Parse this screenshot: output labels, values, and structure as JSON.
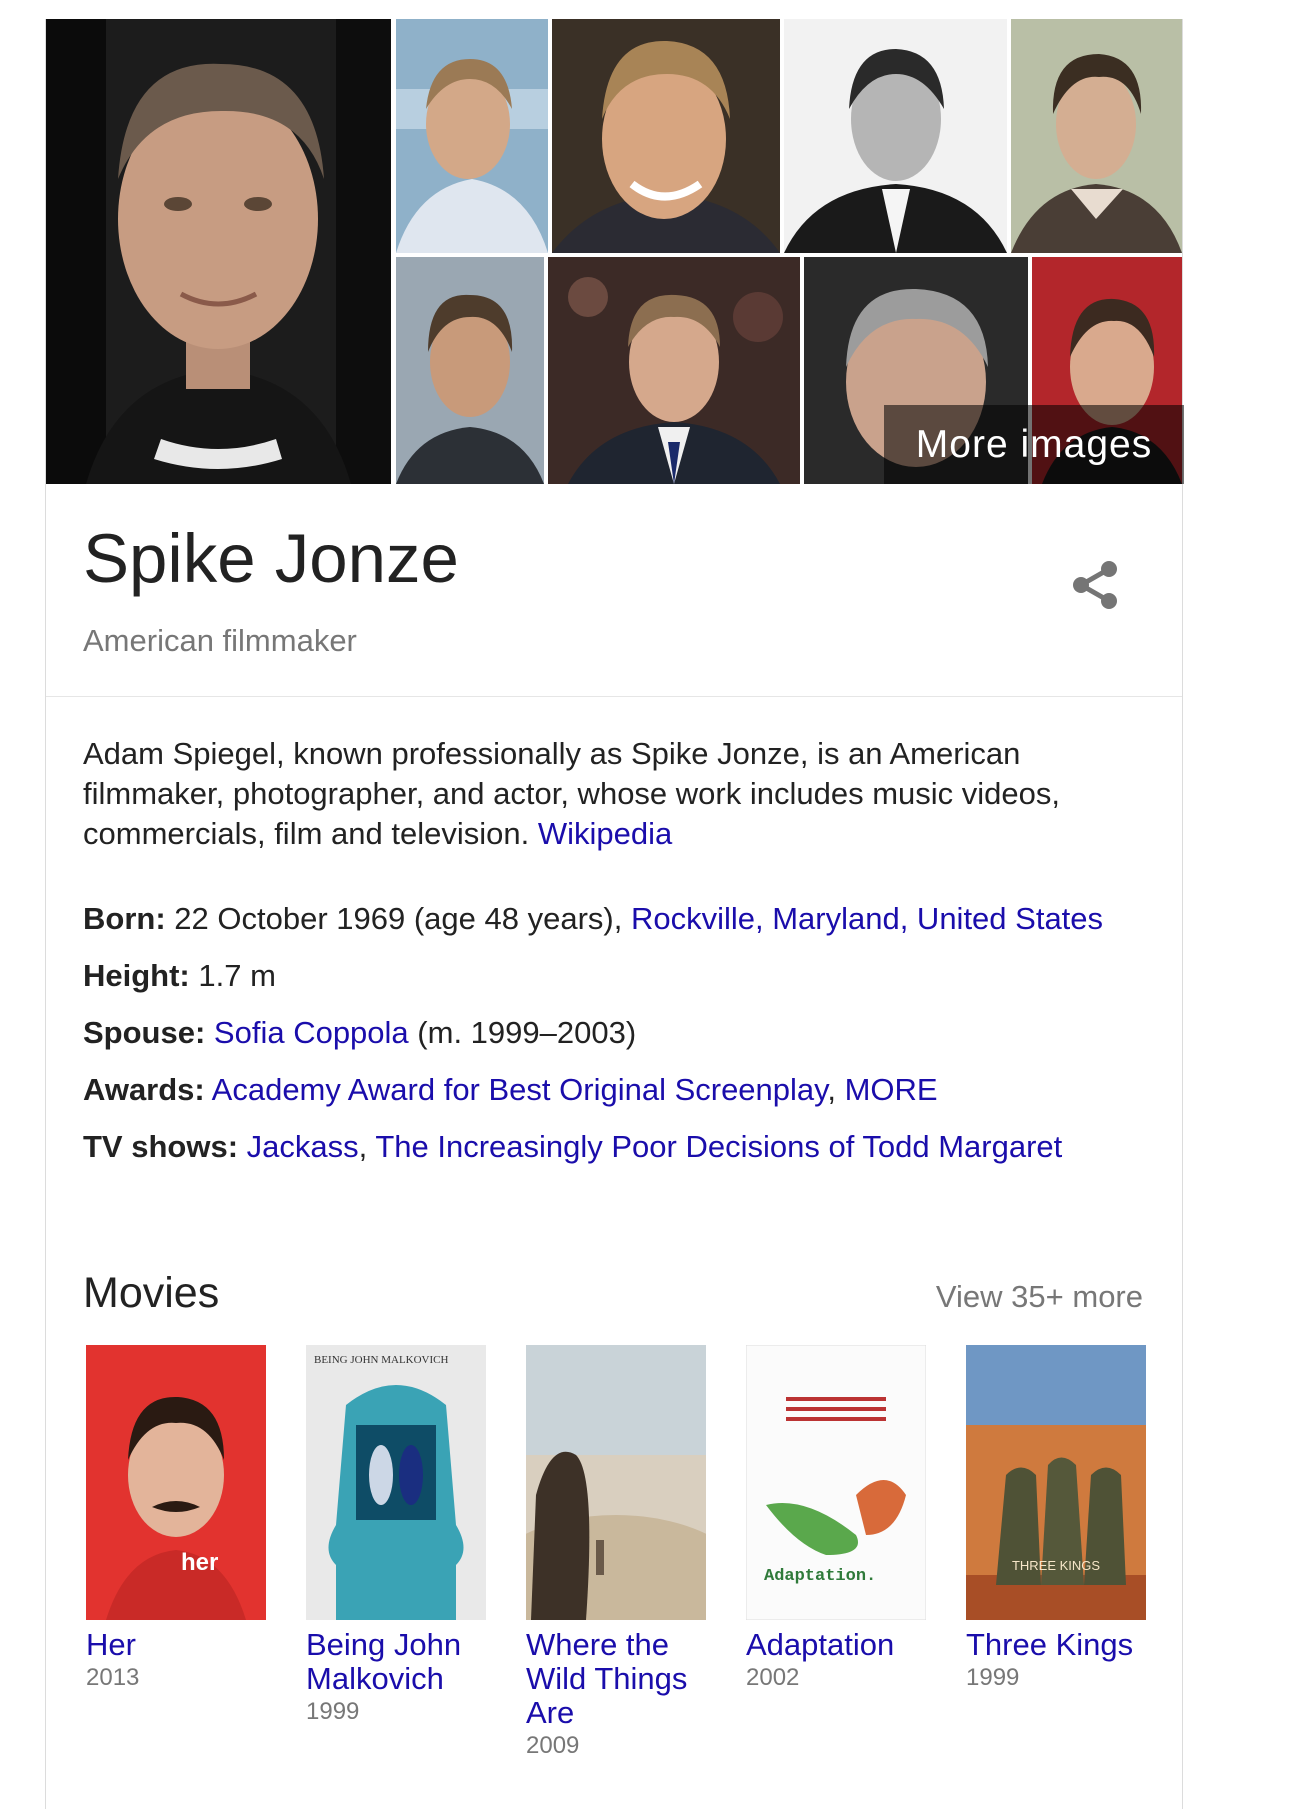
{
  "gallery": {
    "more_images_label": "More images"
  },
  "entity": {
    "name": "Spike Jonze",
    "subtitle": "American filmmaker"
  },
  "description": {
    "text": "Adam Spiegel, known professionally as Spike Jonze, is an American filmmaker, photographer, and actor, whose work includes music videos, commercials, film and television.",
    "source_link": "Wikipedia"
  },
  "facts": {
    "born": {
      "label": "Born:",
      "value": "22 October 1969 (age 48 years),",
      "link": "Rockville, Maryland, United States"
    },
    "height": {
      "label": "Height:",
      "value": "1.7 m"
    },
    "spouse": {
      "label": "Spouse:",
      "link": "Sofia Coppola",
      "value": "(m. 1999–2003)"
    },
    "awards": {
      "label": "Awards:",
      "link": "Academy Award for Best Original Screenplay",
      "separator": ",",
      "more": "MORE"
    },
    "tv_shows": {
      "label": "TV shows:",
      "links": [
        "Jackass",
        "The Increasingly Poor Decisions of Todd Margaret"
      ],
      "separator": ","
    }
  },
  "movies": {
    "heading": "Movies",
    "view_more": "View 35+ more",
    "items": [
      {
        "title": "Her",
        "year": "2013",
        "poster_text": "her"
      },
      {
        "title": "Being John Malkovich",
        "year": "1999",
        "poster_text": "BEING JOHN MALKOVICH"
      },
      {
        "title": "Where the Wild Things Are",
        "year": "2009",
        "poster_text": ""
      },
      {
        "title": "Adaptation",
        "year": "2002",
        "poster_text": "Adaptation."
      },
      {
        "title": "Three Kings",
        "year": "1999",
        "poster_text": "THREE KINGS"
      }
    ]
  },
  "colors": {
    "link": "#1a0dab",
    "text": "#222222",
    "muted": "#777777",
    "divider": "#e6e6e6"
  }
}
